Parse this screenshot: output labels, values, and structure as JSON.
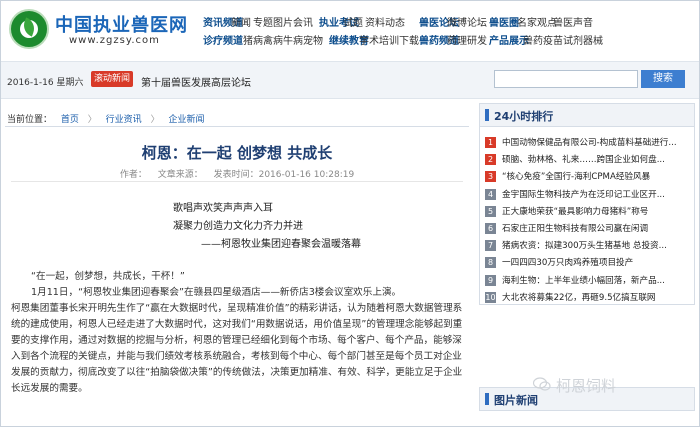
{
  "header": {
    "site_title": "中国执业兽医网",
    "site_url": "www.zgzsy.com",
    "nav_row1": [
      "资讯频道",
      "新闻",
      "专题",
      "图片",
      "会讯",
      "执业考试",
      "试题",
      "资料",
      "动态",
      "兽医论坛",
      "微博",
      "论坛",
      "兽医圈",
      "名家观点",
      "兽医声音"
    ],
    "nav_row2": [
      "诊疗频道",
      "猪病",
      "禽病",
      "牛病",
      "宠物",
      "继续教育",
      "学术",
      "培训",
      "下载",
      "兽药频道",
      "药理",
      "研发",
      "产品展示",
      "兽药",
      "疫苗",
      "试剂",
      "器械"
    ]
  },
  "search_bar": {
    "date": "2016-1-16 星期六",
    "news_tag": "滚动新闻",
    "news_link": "第十届兽医发展高层论坛",
    "search_placeholder": "",
    "search_button": "搜索"
  },
  "breadcrumb": {
    "prefix": "当前位置：",
    "items": [
      "首页",
      "行业资讯",
      "企业新闻"
    ]
  },
  "article": {
    "title": "柯恩：在一起 创梦想 共成长",
    "author_label": "作者：",
    "source_label": "文章来源：",
    "time_label": "发表时间：2016-01-16 10:28:19",
    "poem": [
      "歌唱声欢笑声声声入耳",
      "凝聚力创造力文化力齐力并进",
      "——柯恩牧业集团迎春聚会温暖落幕"
    ],
    "paragraphs": [
      "“在一起，创梦想，共成长，干杯！”",
      "1月11日，“柯恩牧业集团迎春聚会”在赣县四星级酒店——新侨店3楼会议室欢乐上演。",
      "柯恩集团董事长宋开明先生作了“赢在大数据时代，呈现精准价值”的精彩讲话，认为随着柯恩大数据管理系统的建成使用，柯恩人已经走进了大数据时代，这对我们“用数据说话，用价值呈现”的管理理念能够起到重要的支撑作用，通过对数据的挖掘与分析，柯恩的管理已经细化到每个市场、每个客户、每个产品，能够深入到各个流程的关键点，并能与我们绩效考核系统融合，考核到每个中心、每个部门甚至是每个员工对企业发展的贡献力，彻底改变了以往“拍脑袋做决策”的传统做法，决策更加精准、有效、科学，更能立足于企业长远发展的需要。"
    ]
  },
  "sidebar": {
    "ranking_title": "24小时排行",
    "ranking": [
      "中国动物保健品有限公司-构成苗料基础进行...",
      "硕脑、勃林格、礼来……跨国企业如何盘...",
      "“核心免疫”全国行-海利CPMA经验风暴",
      "金宇国际生物科技产为在泛印记工业区开...",
      "正大康地荣获“最具影响力母猪料”称号",
      "石家庄正阳生物科技有限公司赢在闲调",
      "猪病农资：拟建300万头生猪基地 总投资...",
      "一四四四30万只肉鸡养殖项目投产",
      "海利生物：上半年业绩小幅回落，新产品...",
      "大北农将募集22亿，再砸9.5亿搞互联网"
    ],
    "rank_colors": [
      "#d83a28",
      "#d83a28",
      "#d83a28",
      "#7a8594",
      "#7a8594",
      "#7a8594",
      "#7a8594",
      "#7a8594",
      "#7a8594",
      "#7a8594"
    ],
    "pic_title": "图片新闻"
  },
  "watermark": "柯恩饲料"
}
